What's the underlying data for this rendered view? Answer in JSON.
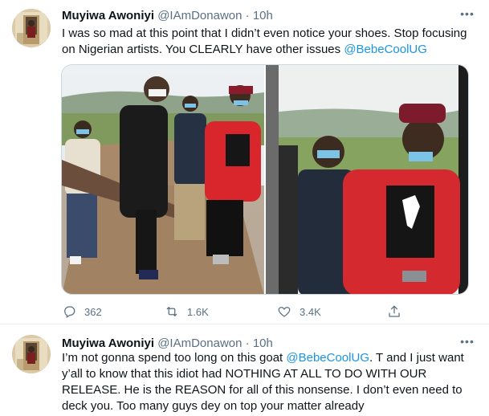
{
  "tweets": [
    {
      "author_name": "Muyiwa Awoniyi",
      "handle": "@IAmDonawon",
      "separator": "·",
      "time": "10h",
      "text_part1": "I was so mad at this point that I didn’t even notice your shoes. Stop focusing on Nigerian artists. You CLEARLY have other issues ",
      "mention": "@BebeCoolUG",
      "text_part2": "",
      "more_label": "•••",
      "media_count": 2,
      "actions": {
        "reply_count": "362",
        "retweet_count": "1.6K",
        "like_count": "3.4K"
      }
    },
    {
      "author_name": "Muyiwa Awoniyi",
      "handle": "@IAmDonawon",
      "separator": "·",
      "time": "10h",
      "text_part1": "I’m not gonna spend too long on this goat ",
      "mention": "@BebeCoolUG",
      "text_part2": ". T and I just want y’all to know that this idiot had NOTHING AT ALL TO DO WITH OUR RELEASE. He is the REASON for all of this nonsense. I don’t even need to deck you. Too many guys dey on top your matter already",
      "more_label": "•••"
    }
  ],
  "colors": {
    "accent": "#1b95e0",
    "text": "#0f1419",
    "secondary": "#5b7083",
    "divider": "#e6ecf0"
  },
  "icons": {
    "reply": "reply-icon",
    "retweet": "retweet-icon",
    "like": "heart-icon",
    "share": "share-icon",
    "more": "more-icon"
  }
}
